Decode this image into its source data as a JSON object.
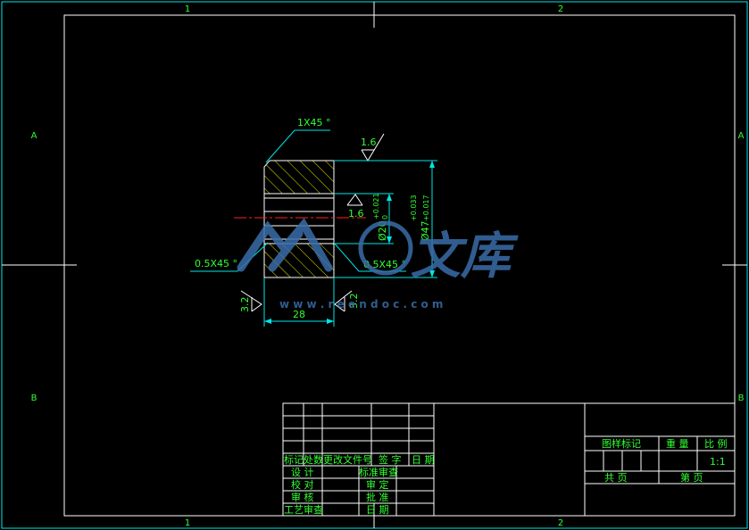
{
  "frame": {
    "zone_columns": [
      "1",
      "2"
    ],
    "zone_rows": [
      "A",
      "B"
    ]
  },
  "part": {
    "chamfer_top": "1X45 °",
    "chamfer_left": "0.5X45 °",
    "chamfer_right": "0.5X45 °",
    "roughness_top": "1.6",
    "roughness_bore": "1.6",
    "roughness_left": "3.2",
    "roughness_right": "3.2",
    "width_dim": "28",
    "bore_dia": "Ø20",
    "bore_tol_upper": "+0.021",
    "bore_tol_lower": "0",
    "outer_dia": "Ø47",
    "outer_tol_upper": "+0.033",
    "outer_tol_lower": "+0.017"
  },
  "watermark": {
    "text": "文库",
    "url": "w w w . r e   e n d o c . c o m"
  },
  "title_block": {
    "header_row": [
      "标记",
      "处数",
      "更改文件号",
      "签 字",
      "日 期"
    ],
    "left_rows": [
      [
        "设 计",
        "标准审查"
      ],
      [
        "校 对",
        "审 定"
      ],
      [
        "审 核",
        "批 准"
      ],
      [
        "工艺审查",
        "日 期"
      ]
    ],
    "right_labels": {
      "drawing_mark": "图样标记",
      "weight": "重 量",
      "scale": "比 例",
      "scale_value": "1:1",
      "total_sheets": "共    页",
      "sheet_no": "第    页"
    }
  },
  "colors": {
    "background": "#000000",
    "outline": "#ffffff",
    "text": "#32ff32",
    "dimension": "#00e6e6",
    "hatch": "#e6e600",
    "centerline": "#ff2020",
    "watermark": "#3a6da8"
  }
}
